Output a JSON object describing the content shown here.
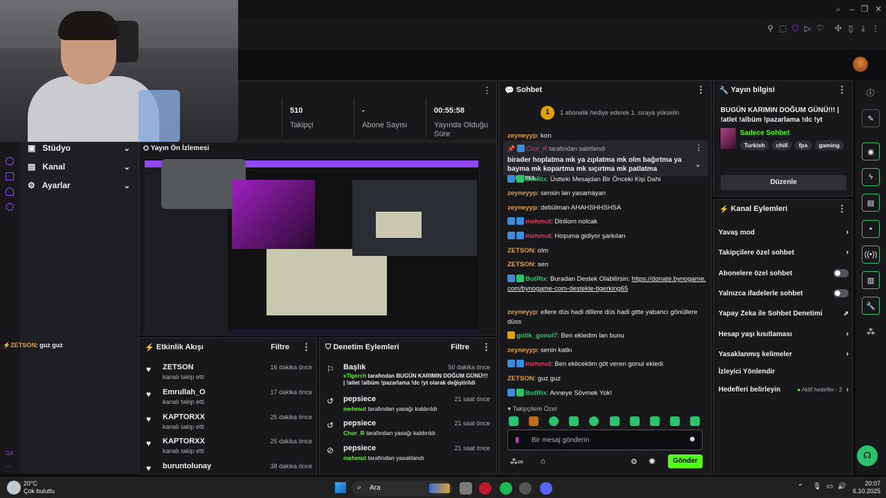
{
  "chat_notice": "1 abonelik hediye ederek 1. sıraya yükselin",
  "stats": [
    {
      "value": "510",
      "label": "Takipçi"
    },
    {
      "value": "-",
      "label": "Abone Sayısı"
    },
    {
      "value": "00:55:58",
      "label": "Yayında Olduğu Süre"
    }
  ],
  "left_nav": {
    "items": [
      {
        "label": "Stüdyo"
      },
      {
        "label": "Kanal"
      },
      {
        "label": "Ayarlar"
      }
    ]
  },
  "left_chat_overlay": {
    "user": "ZETSON",
    "text": ": guz guz"
  },
  "preview": {
    "title": "Yayın Ön İzlemesi"
  },
  "activity": {
    "title": "Etkinlik Akışı",
    "filter": "Filtre",
    "items": [
      {
        "name": "ZETSON",
        "action": "kanalı takip etti",
        "time": "16 dakika önce"
      },
      {
        "name": "Emrullah_O",
        "action": "kanalı takip etti",
        "time": "17 dakika önce"
      },
      {
        "name": "KAPTORXX",
        "action": "kanalı takip etti",
        "time": "25 dakika önce"
      },
      {
        "name": "KAPTORXX",
        "action": "kanalı takip etti",
        "time": "25 dakika önce"
      },
      {
        "name": "buruntolunay",
        "action": "",
        "time": "38 dakika önce"
      }
    ]
  },
  "moderation": {
    "title": "Denetim Eylemleri",
    "filter": "Filtre",
    "items": [
      {
        "name": "Başlık",
        "actor": "xTigerch",
        "action": " tarafından BUGÜN KARIMIN DOĞUM GÜNÜ!!! | !atlet !albüm !pazarlama !dc !yt olarak değiştirildi",
        "time": "50 dakika önce"
      },
      {
        "name": "pepsiece",
        "actor": "mehmut",
        "action": " tarafından yasağı kaldırıldı",
        "time": "21 saat önce"
      },
      {
        "name": "pepsiece",
        "actor": "Chor_R",
        "action": " tarafından yasağı kaldırıldı",
        "time": "21 saat önce"
      },
      {
        "name": "pepsiece",
        "actor": "mehmut",
        "action": " tarafından yasaklandı",
        "time": "21 saat önce"
      }
    ]
  },
  "chat": {
    "title": "Sohbet",
    "pinned_by": "Chor_R",
    "pinned_suffix": " tarafından sabitlendi",
    "pinned_text": "birader hoplatma mk ya zıplatma mk olm bağırtma ya bayma mk kopartma mk sıçırtma mk patlatma osurtma...",
    "messages": [
      {
        "user": "zeyneyyp",
        "text": ": kon",
        "color": "#e0a040"
      },
      {
        "user": "BotRix",
        "text": ": Üstteki Mesajdan Bir Önceki Kişi Dahi",
        "color": "#2bc36e"
      },
      {
        "user": "zeyneyyp",
        "text": ": sensin lan yasamayan",
        "color": "#e0a040"
      },
      {
        "user": "zeyneyyp",
        "text": ": debülman AHAHSHHSHSA",
        "color": "#e0a040"
      },
      {
        "user": "mehmut",
        "text": ": Dinliom nolcak",
        "color": "#e0365c"
      },
      {
        "user": "mehmut",
        "text": ": Hoşuma gidiyor şarkıları",
        "color": "#e0365c"
      },
      {
        "user": "ZETSON",
        "text": ": olm",
        "color": "#e0a040"
      },
      {
        "user": "ZETSON",
        "text": ": sen",
        "color": "#e0a040"
      },
      {
        "user": "BotRix",
        "text": ": Buradan Destek Olabilirsin: ",
        "link": "https://donate.bynogame.com/bynogame-com-destekle-tigerking65",
        "color": "#2bc36e"
      },
      {
        "user": "zeyneyyp",
        "text": ": ellere düs hadi dillere düs hadi gitte yabancı gönüllere düss",
        "color": "#e0a040"
      },
      {
        "user": "gotik_gonul7",
        "text": ": Ben ekledim lan bunu",
        "color": "#2bc36e"
      },
      {
        "user": "zeyneyyp",
        "text": ": senin katkı",
        "color": "#e0a040"
      },
      {
        "user": "mehmut",
        "text": ": Ben eklicektim göt veren gonul ekledi",
        "color": "#e0365c"
      },
      {
        "user": "ZETSON",
        "text": ": guz guz",
        "color": "#e0a040"
      },
      {
        "user": "BotRix",
        "text": ": Anneye Sövmek Yok!",
        "color": "#2bc36e"
      }
    ],
    "followers_only": "Takipçilere Özel",
    "input_placeholder": "Bir mesaj gönderin",
    "send": "Gönder"
  },
  "stream_info": {
    "title": "Yayın bilgisi",
    "stream_title": "BUGÜN KARIMIN DOĞUM GÜNÜ!!! | !atlet !albüm !pazarlama !dc !yt",
    "category": "Sadece Sohbet",
    "tags": [
      "Turkish",
      "chill",
      "fps",
      "gaming"
    ],
    "edit": "Düzenle"
  },
  "channel_actions": {
    "title": "Kanal Eylemleri",
    "items": [
      {
        "label": "Yavaş mod"
      },
      {
        "label": "Takipçilere özel sohbet"
      },
      {
        "label": "Abonelere özel sohbet"
      },
      {
        "label": "Yalnızca ifadelerle sohbet"
      },
      {
        "label": "Yapay Zeka ile Sohbet Denetimi"
      },
      {
        "label": "Hesap yaşı kısıtlaması"
      },
      {
        "label": "Yasaklanmış kelimeler"
      },
      {
        "label": "İzleyici Yönlendir"
      },
      {
        "label": "Hedefleri belirleyin",
        "extra": "Aktif hedefler - 2"
      }
    ]
  },
  "taskbar": {
    "weather_temp": "20°C",
    "weather_desc": "Çok bulutlu",
    "search": "Ara",
    "time": "20:07",
    "date": "6.10.2025"
  },
  "colors": {
    "accent": "#53fc18",
    "purple": "#9147ff",
    "bg": "#0e0e10",
    "panel": "#18181b"
  }
}
